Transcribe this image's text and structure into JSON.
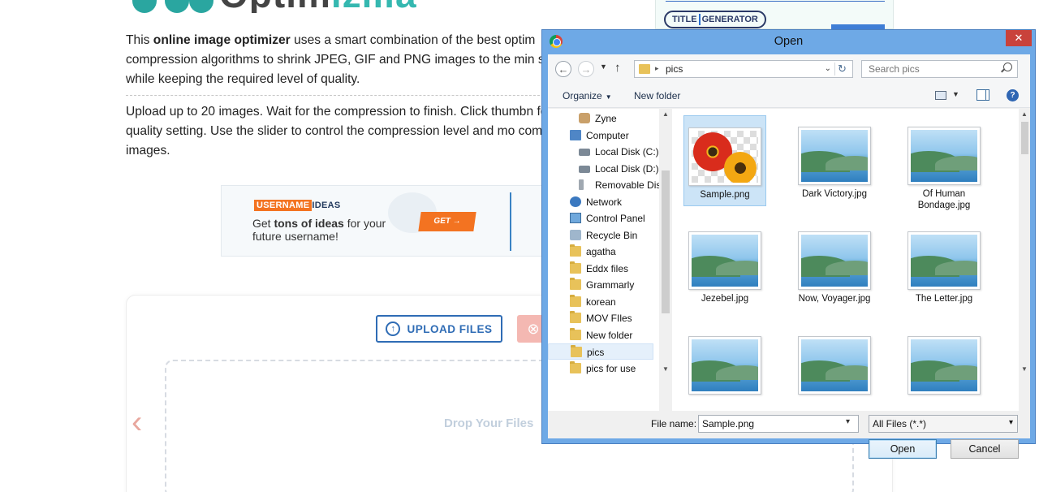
{
  "page": {
    "logo_text_dark": "Optim",
    "logo_text_accent": "izilla",
    "intro_pre": "This ",
    "intro_bold": "online image optimizer",
    "intro_post": " uses a smart combination of the best optim compression algorithms to shrink JPEG, GIF and PNG images to the min size while keeping the required level of quality.",
    "instructions": "Upload up to 20 images. Wait for the compression to finish. Click thumbn for quality setting. Use the slider to control the compression level and mo compare images.",
    "ad": {
      "brand_box": "USERNAME",
      "brand_text": "IDEAS",
      "copy_pre": "Get ",
      "copy_bold": "tons of ideas",
      "copy_post": " for your future username!",
      "cta": "GET →"
    },
    "title_ad": {
      "word1": "TITLE",
      "word2": "GENERATOR"
    },
    "upload_button": "UPLOAD FILES",
    "clear_icon": "⊗",
    "drop_text": "Drop Your Files",
    "prev_arrow": "‹"
  },
  "dialog": {
    "title": "Open",
    "close": "✕",
    "address": {
      "path": "pics"
    },
    "search": {
      "placeholder": "Search pics"
    },
    "toolbar": {
      "organize": "Organize",
      "new_folder": "New folder"
    },
    "nav_items": [
      {
        "label": "Zyne",
        "icon": "user-folder-icon"
      },
      {
        "label": "Computer",
        "icon": "computer-icon"
      },
      {
        "label": "Local Disk (C:)",
        "icon": "disk-icon"
      },
      {
        "label": "Local Disk (D:)",
        "icon": "disk-icon"
      },
      {
        "label": "Removable Dis",
        "icon": "usb-icon"
      },
      {
        "label": "Network",
        "icon": "network-icon"
      },
      {
        "label": "Control Panel",
        "icon": "control-panel-icon"
      },
      {
        "label": "Recycle Bin",
        "icon": "recycle-bin-icon"
      },
      {
        "label": "agatha",
        "icon": "folder-icon"
      },
      {
        "label": "Eddx files",
        "icon": "folder-icon"
      },
      {
        "label": "Grammarly",
        "icon": "folder-icon"
      },
      {
        "label": "korean",
        "icon": "folder-icon"
      },
      {
        "label": "MOV FIles",
        "icon": "folder-icon"
      },
      {
        "label": "New folder",
        "icon": "folder-icon"
      },
      {
        "label": "pics",
        "icon": "folder-icon",
        "selected": true
      },
      {
        "label": "pics for use",
        "icon": "folder-icon"
      }
    ],
    "files": [
      {
        "name": "Sample.png",
        "selected": true,
        "kind": "flowers"
      },
      {
        "name": "Dark Victory.jpg",
        "kind": "landscape"
      },
      {
        "name": "Of Human Bondage.jpg",
        "kind": "landscape"
      },
      {
        "name": "Jezebel.jpg",
        "kind": "landscape"
      },
      {
        "name": "Now, Voyager.jpg",
        "kind": "landscape"
      },
      {
        "name": "The Letter.jpg",
        "kind": "landscape"
      },
      {
        "name": "",
        "kind": "landscape"
      },
      {
        "name": "",
        "kind": "landscape"
      },
      {
        "name": "",
        "kind": "landscape"
      }
    ],
    "file_name_label": "File name:",
    "file_name_value": "Sample.png",
    "file_type": "All Files (*.*)",
    "open_button": "Open",
    "cancel_button": "Cancel"
  },
  "colors": {
    "dialog_frame": "#6ea9e6",
    "upload_blue": "#2f6cb5",
    "ad_orange": "#f37321",
    "selection": "#cce4f7"
  }
}
